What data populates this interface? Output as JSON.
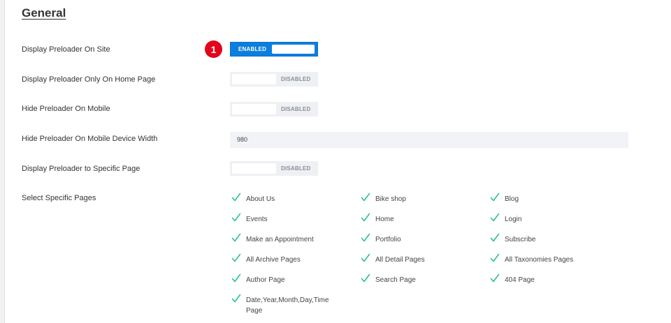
{
  "section": {
    "title": "General"
  },
  "step_badge": "1",
  "settings": {
    "display_preloader": {
      "label": "Display Preloader On Site",
      "state": "ENABLED"
    },
    "home_only": {
      "label": "Display Preloader Only On Home Page",
      "state": "DISABLED"
    },
    "hide_mobile": {
      "label": "Hide Preloader On Mobile",
      "state": "DISABLED"
    },
    "mobile_width": {
      "label": "Hide Preloader On Mobile Device Width",
      "value": "980"
    },
    "specific_page": {
      "label": "Display Preloader to Specific Page",
      "state": "DISABLED"
    },
    "select_pages": {
      "label": "Select Specific Pages"
    }
  },
  "pages": [
    {
      "label": "About Us",
      "checked": true
    },
    {
      "label": "Bike shop",
      "checked": true
    },
    {
      "label": "Blog",
      "checked": true
    },
    {
      "label": "Events",
      "checked": true
    },
    {
      "label": "Home",
      "checked": true
    },
    {
      "label": "Login",
      "checked": true
    },
    {
      "label": "Make an Appointment",
      "checked": true
    },
    {
      "label": "Portfolio",
      "checked": true
    },
    {
      "label": "Subscribe",
      "checked": true
    },
    {
      "label": "All Archive Pages",
      "checked": true
    },
    {
      "label": "All Detail Pages",
      "checked": true
    },
    {
      "label": "All Taxonomies Pages",
      "checked": true
    },
    {
      "label": "Author Page",
      "checked": true
    },
    {
      "label": "Search Page",
      "checked": true
    },
    {
      "label": "404 Page",
      "checked": true
    },
    {
      "label": "Date,Year,Month,Day,Time Page",
      "checked": true
    }
  ],
  "colors": {
    "accent": "#0c7ee0",
    "badge": "#e3051b",
    "check": "#2bbf9a"
  },
  "icons": {
    "check": "check-icon"
  }
}
